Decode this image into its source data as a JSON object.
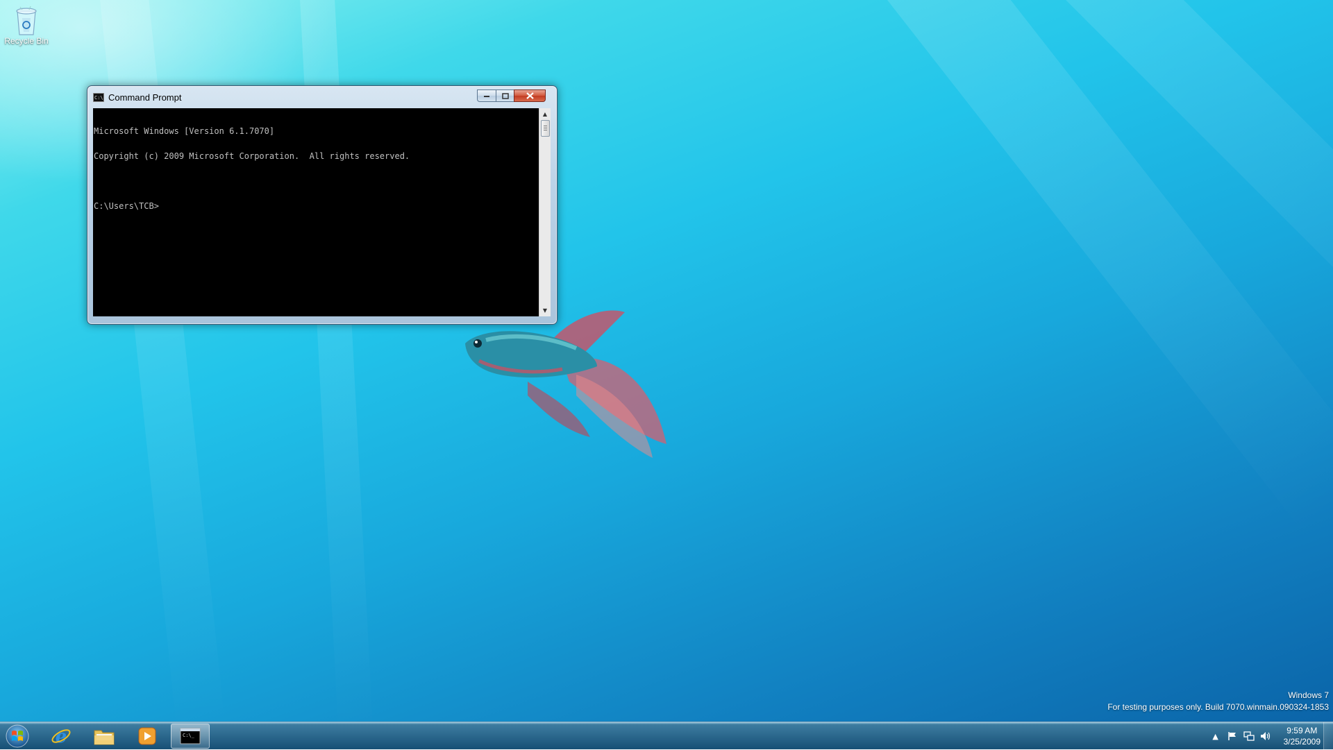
{
  "desktop": {
    "icons": [
      {
        "label": "Recycle Bin",
        "icon": "recycle-bin-icon"
      }
    ],
    "watermark": {
      "line1": "Windows 7",
      "line2": "For testing purposes only. Build 7070.winmain.090324-1853"
    }
  },
  "cmd_window": {
    "title": "Command Prompt",
    "icon": "cmd-app-icon",
    "controls": [
      "minimize",
      "maximize",
      "close"
    ],
    "lines": [
      "Microsoft Windows [Version 6.1.7070]",
      "Copyright (c) 2009 Microsoft Corporation.  All rights reserved.",
      "",
      "C:\\Users\\TCB>"
    ],
    "colors": {
      "console_bg": "#000000",
      "console_fg": "#c0c0c0"
    }
  },
  "taskbar": {
    "start_icon": "windows-logo-icon",
    "pinned": [
      {
        "name": "Internet Explorer",
        "icon": "internet-explorer-icon"
      },
      {
        "name": "Windows Explorer",
        "icon": "folder-icon"
      },
      {
        "name": "Windows Media Player",
        "icon": "media-player-icon"
      },
      {
        "name": "Command Prompt",
        "icon": "cmd-icon",
        "active": true
      }
    ],
    "tray": {
      "icons": [
        "show-hidden-icons-arrow",
        "action-center-flag-icon",
        "network-icon",
        "volume-icon"
      ],
      "time": "9:59 AM",
      "date": "3/25/2009"
    }
  }
}
